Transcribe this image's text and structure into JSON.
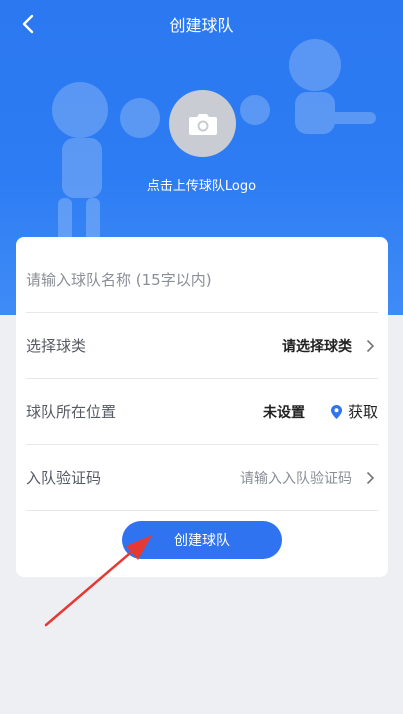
{
  "header": {
    "title": "创建球队",
    "back_icon": "back-chevron-icon"
  },
  "avatar": {
    "icon": "camera-icon",
    "upload_label": "点击上传球队Logo"
  },
  "form": {
    "name_placeholder": "请输入球队名称 (15字以内)",
    "sport": {
      "label": "选择球类",
      "value": "请选择球类"
    },
    "location": {
      "label": "球队所在位置",
      "value": "未设置",
      "fetch_label": "获取"
    },
    "verify": {
      "label": "入队验证码",
      "placeholder": "请输入入队验证码"
    }
  },
  "actions": {
    "create_label": "创建球队"
  },
  "colors": {
    "primary": "#2f73f0",
    "hero": "#2d7cf3",
    "annotation": "#e53935"
  }
}
